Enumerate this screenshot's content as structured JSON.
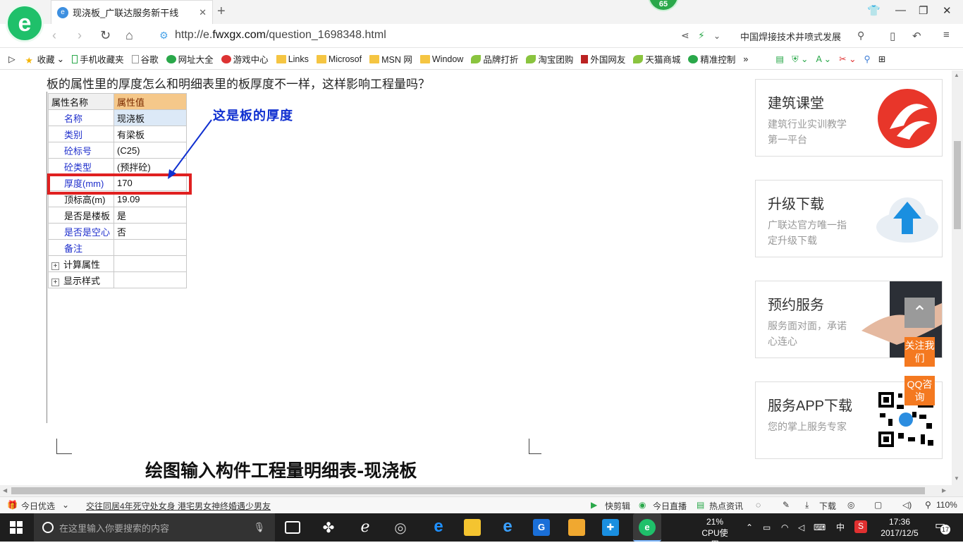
{
  "browser": {
    "tab_title": "现浇板_广联达服务新干线",
    "badge": "65",
    "url_prefix": "http://e.",
    "url_domain": "fwxgx.com",
    "url_path": "/question_1698348.html",
    "search_text": "中国焊接技术井喷式发展"
  },
  "bookmarks": [
    "收藏",
    "手机收藏夹",
    "谷歌",
    "网址大全",
    "游戏中心",
    "Links",
    "Microsof",
    "MSN 网",
    "Window",
    "品牌打折",
    "淘宝团购",
    "外国网友",
    "天猫商城",
    "精准控制"
  ],
  "bookmarks_more": "»",
  "question": "板的属性里的厚度怎么和明细表里的板厚度不一样，这样影响工程量吗？",
  "props_table": {
    "header": [
      "属性名称",
      "属性值"
    ],
    "rows": [
      {
        "k": "名称",
        "v": "现浇板"
      },
      {
        "k": "类别",
        "v": "有梁板"
      },
      {
        "k": "砼标号",
        "v": "(C25)"
      },
      {
        "k": "砼类型",
        "v": "(预拌砼)"
      },
      {
        "k": "厚度(mm)",
        "v": "170"
      },
      {
        "k": "顶标高(m)",
        "v": "19.09"
      },
      {
        "k": "是否是楼板",
        "v": "是"
      },
      {
        "k": "是否是空心",
        "v": "否"
      },
      {
        "k": "备注",
        "v": ""
      }
    ],
    "groups": [
      "计算属性",
      "显示样式"
    ]
  },
  "annotation": "这是板的厚度",
  "doc_title": "绘图输入构件工程量明细表-现浇板",
  "sidebar": [
    {
      "title": "建筑课堂",
      "sub": "建筑行业实训教学第一平台"
    },
    {
      "title": "升级下载",
      "sub": "广联达官方唯一指定升级下载"
    },
    {
      "title": "预约服务",
      "sub": "服务面对面，承诺心连心"
    },
    {
      "title": "服务APP下载",
      "sub": "您的掌上服务专家"
    }
  ],
  "float_buttons": [
    "关注我们",
    "QQ咨询"
  ],
  "statusbar": {
    "left1": "今日优选",
    "news": "交往同居4年死守处女身 港宅男女神终婚遇少男友",
    "items": [
      "快剪辑",
      "今日直播",
      "热点资讯",
      "下载"
    ],
    "zoom": "110%"
  },
  "taskbar": {
    "search_placeholder": "在这里输入你要搜索的内容",
    "cpu_percent": "21%",
    "cpu_label": "CPU使用",
    "ime": "中",
    "time": "17:36",
    "date": "2017/12/5",
    "notif": "17"
  },
  "colors": {
    "accent_green": "#1fc06a",
    "annotation_blue": "#1030d0",
    "highlight_red": "#e02020",
    "float_orange": "#f47920"
  }
}
